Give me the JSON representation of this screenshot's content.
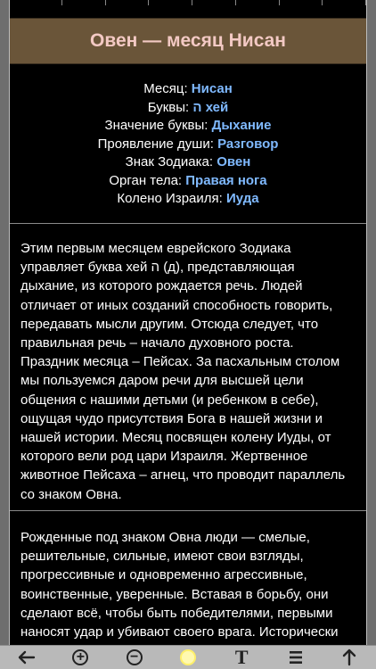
{
  "header": {
    "title": "Овен — месяц Нисан"
  },
  "info": [
    {
      "label": "Месяц: ",
      "value": "Нисан"
    },
    {
      "label": "Буквы: ",
      "value": "ה хей"
    },
    {
      "label": "Значение буквы: ",
      "value": "Дыхание"
    },
    {
      "label": "Проявление души: ",
      "value": "Разговор"
    },
    {
      "label": "Знак Зодиака: ",
      "value": "Овен"
    },
    {
      "label": "Орган тела: ",
      "value": "Правая нога"
    },
    {
      "label": "Колено Израиля: ",
      "value": "Иуда"
    }
  ],
  "paragraphs": {
    "p1": "Этим первым месяцем еврейского Зодиака управляет буква хей ה (д), представляющая дыхание, из которого рождается речь. Людей отличает от иных созданий способность говорить, передавать мысли другим. Отсюда следует, что правильная речь – начало духовного роста. Праздник месяца – Пейсах. За пасхальным столом мы пользуемся даром речи для высшей цели общения с нашими детьми (и ребенком в себе), ощущая чудо присутствия Бога в нашей жизни и нашей истории. Месяц посвящен колену Иуды, от которого вели род цари Израиля. Жертвенное животное Пейсаха – агнец, что проводит параллель со знаком Овна.",
    "p2": "Рожденные под знаком Овна люди — смелые, решительные, сильные, имеют свои взгляды, прогрессивные и одновременно агрессивные, воинственные, уверенные. Вставая в борьбу, они сделают всё, чтобы быть победителями, первыми наносят удар и убивают своего врага. Исторически месяц Нисан знаменует собой"
  },
  "toolbar": {
    "back": "back-arrow-icon",
    "zoom_in": "zoom-in-icon",
    "zoom_out": "zoom-out-icon",
    "brightness": "brightness-icon",
    "font": "T",
    "list": "list-icon",
    "top": "up-arrow-icon"
  },
  "colors": {
    "header_bg": "#6a5539",
    "title": "#f3c9c4",
    "value": "#7fb9ff",
    "background": "#000000"
  }
}
